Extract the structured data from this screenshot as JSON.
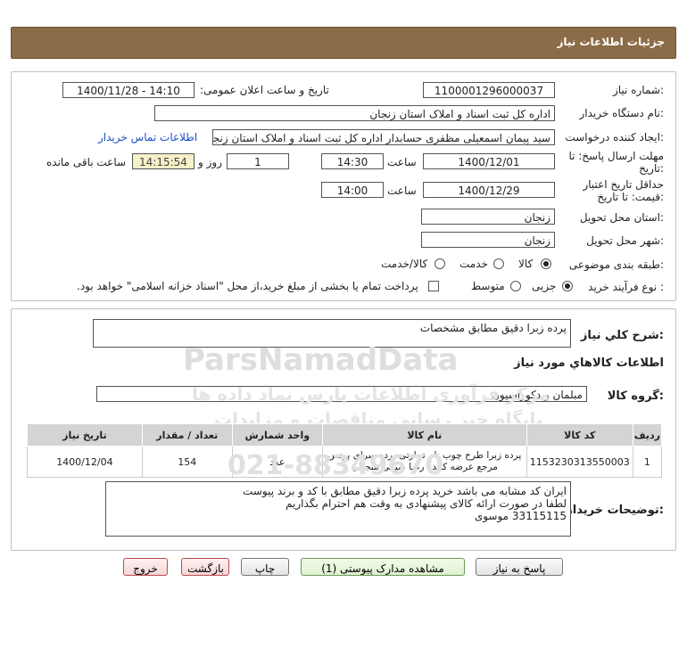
{
  "header": {
    "title": "جزئیات اطلاعات نیاز"
  },
  "form": {
    "need_number_label": "شماره نیاز:",
    "need_number": "1100001296000037",
    "announce_label": "تاریخ و ساعت اعلان عمومی:",
    "announce_value": "1400/11/28 - 14:10",
    "buyer_org_label": "نام دستگاه خریدار:",
    "buyer_org": "اداره کل ثبت اسناد و املاک استان زنجان",
    "creator_label": "ایجاد کننده درخواست:",
    "creator": "سید پیمان اسمعیلی مظفری حسابدار اداره کل ثبت اسناد و املاک استان زنجان",
    "contact_link": "اطلاعات تماس خریدار",
    "deadline_label_1": "مهلت ارسال پاسخ: تا",
    "deadline_label_2": "تاریخ:",
    "deadline_date": "1400/12/01",
    "time_label": "ساعت",
    "deadline_time": "14:30",
    "days_value": "1",
    "days_label": "روز و",
    "remaining_time": "14:15:54",
    "remaining_label": "ساعت باقی مانده",
    "validity_label_1": "حداقل تاریخ اعتبار",
    "validity_label_2": "قیمت: تا تاریخ:",
    "validity_date": "1400/12/29",
    "validity_time_label": "ساعت",
    "validity_time": "14:00",
    "province_label": "استان محل تحویل:",
    "province": "زنجان",
    "city_label": "شهر محل تحویل:",
    "city": "زنجان",
    "category_label": "طبقه بندی موضوعی:",
    "category_options": [
      "کالا",
      "خدمت",
      "کالا/خدمت"
    ],
    "process_label": "نوع فرآیند خرید :",
    "process_options": [
      "جزیی",
      "متوسط"
    ],
    "payment_note": "پرداخت تمام یا بخشی از مبلغ خرید،از محل \"اسناد خزانه اسلامی\" خواهد بود."
  },
  "details": {
    "summary_label": "شرح کلي نياز:",
    "summary": "پرده زبرا دقیق مطابق مشخصات",
    "goods_info_title": "اطلاعات کالاهاي مورد نياز",
    "goods_group_label": "گروه کالا:",
    "goods_group": "مبلمان و دکوراسیون",
    "table": {
      "headers": [
        "ردیف",
        "کد کالا",
        "نام کالا",
        "واحد شمارش",
        "تعداد / مقدار",
        "تاریخ نیاز"
      ],
      "rows": [
        {
          "row": "1",
          "code": "1153230313550003",
          "name": "پرده زبرا طرح چوب نام تجارتی پرده سرای پرنس مرجع عرضه کننده رضا ضیائی منجیلی",
          "unit": "عدد",
          "qty": "154",
          "date": "1400/12/04"
        }
      ]
    },
    "buyer_notes_label": "توضیحات خریدار:",
    "buyer_notes": [
      "ایران کد مشابه می باشد خرید پرده زبرا دقیق مطابق با کد و برند پیوست",
      "لطفا در صورت ارائه کالای پیشنهادی به وقت هم احترام بگذاریم",
      "33115115 موسوی"
    ]
  },
  "buttons": {
    "reply": "پاسخ به نیاز",
    "view_docs": "مشاهده مدارک پیوستی (1)",
    "print": "چاپ",
    "back": "بازگشت",
    "exit": "خروج"
  },
  "watermark": {
    "brand": "ParsNamadData",
    "line1": "پایگاه خبر رسانی مناقصات و مزایدات",
    "line2": "مرکز فرآوری اطلاعات پارس نماد داده ها",
    "phone": "021-88349670"
  }
}
